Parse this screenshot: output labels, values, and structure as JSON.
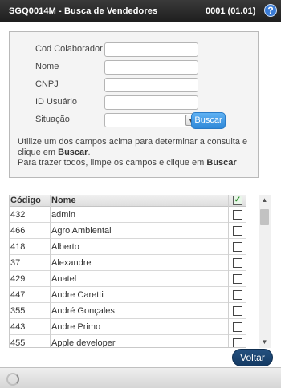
{
  "window": {
    "title": "SGQ0014M - Busca de Vendedores",
    "version": "0001 (01.01)",
    "help_glyph": "?"
  },
  "form": {
    "labels": {
      "cod_colaborador": "Cod Colaborador",
      "nome": "Nome",
      "cnpj": "CNPJ",
      "id_usuario": "ID Usuário",
      "situacao": "Situação"
    },
    "values": {
      "cod_colaborador": "",
      "nome": "",
      "cnpj": "",
      "id_usuario": "",
      "situacao": ""
    },
    "buscar_label": "Buscar",
    "help": {
      "line1_pre": "Utilize um dos campos acima para determinar a consulta e clique em ",
      "line1_bold": "Buscar",
      "line1_post": ".",
      "line2_pre": "Para trazer todos, limpe os campos e clique em ",
      "line2_bold": "Buscar"
    }
  },
  "grid": {
    "headers": {
      "code": "Código",
      "name": "Nome"
    },
    "rows": [
      {
        "code": "432",
        "name": "admin"
      },
      {
        "code": "466",
        "name": "Agro Ambiental"
      },
      {
        "code": "418",
        "name": "Alberto"
      },
      {
        "code": "37",
        "name": "Alexandre"
      },
      {
        "code": "429",
        "name": "Anatel"
      },
      {
        "code": "447",
        "name": "Andre Caretti"
      },
      {
        "code": "355",
        "name": "André Gonçales"
      },
      {
        "code": "443",
        "name": "Andre Primo"
      },
      {
        "code": "455",
        "name": "Apple developer"
      }
    ]
  },
  "voltar_label": "Voltar",
  "colors": {
    "titlebar": "#2a2a2a",
    "accent_button": "#3c93e0",
    "voltar_button": "#1b4570"
  }
}
